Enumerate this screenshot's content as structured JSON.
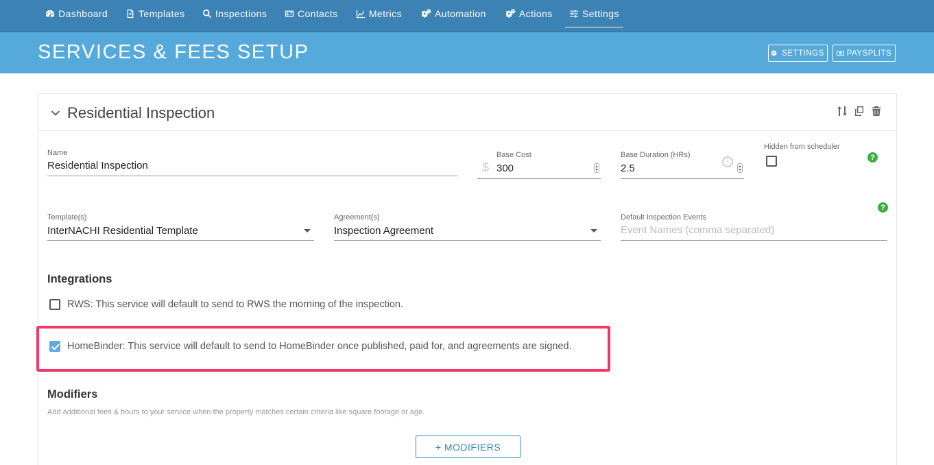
{
  "nav": {
    "items": [
      {
        "label": "Dashboard",
        "icon": "gauge-icon"
      },
      {
        "label": "Templates",
        "icon": "document-icon"
      },
      {
        "label": "Inspections",
        "icon": "search-icon"
      },
      {
        "label": "Contacts",
        "icon": "contact-card-icon"
      },
      {
        "label": "Metrics",
        "icon": "line-chart-icon"
      },
      {
        "label": "Automation",
        "icon": "gears-icon"
      },
      {
        "label": "Actions",
        "icon": "gears-icon"
      },
      {
        "label": "Settings",
        "icon": "sliders-icon"
      }
    ],
    "active": "Settings"
  },
  "header": {
    "title": "SERVICES & FEES SETUP",
    "settings_button": "SETTINGS",
    "paysplits_button": "PAYSPLITS"
  },
  "service": {
    "title": "Residential Inspection",
    "name_label": "Name",
    "name_value": "Residential Inspection",
    "base_cost_label": "Base Cost",
    "currency_symbol": "$",
    "base_cost_value": "300",
    "base_duration_label": "Base Duration (HRs)",
    "base_duration_value": "2.5",
    "hidden_label": "Hidden from scheduler",
    "hidden_checked": false,
    "templates_label": "Template(s)",
    "templates_value": "InterNACHI Residential Template",
    "agreements_label": "Agreement(s)",
    "agreements_value": "Inspection Agreement",
    "events_label": "Default Inspection Events",
    "events_placeholder": "Event Names (comma separated)",
    "help_symbol": "?"
  },
  "integrations": {
    "title": "Integrations",
    "rws_text": "RWS: This service will default to send to RWS the morning of the inspection.",
    "rws_checked": false,
    "homebinder_text": "HomeBinder: This service will default to send to HomeBinder once published, paid for, and agreements are signed.",
    "homebinder_checked": true
  },
  "modifiers": {
    "title": "Modifiers",
    "hint": "Add additional fees & hours to your service when the property matches certain criteria like square footage or age.",
    "button_label": "+ MODIFIERS"
  },
  "colors": {
    "nav_bg": "#3d82b4",
    "header_bg": "#55a9db",
    "highlight": "#f3376b",
    "checkbox_checked": "#63a8e0",
    "help_green": "#3fae3f",
    "button_blue": "#2f8ac2"
  }
}
